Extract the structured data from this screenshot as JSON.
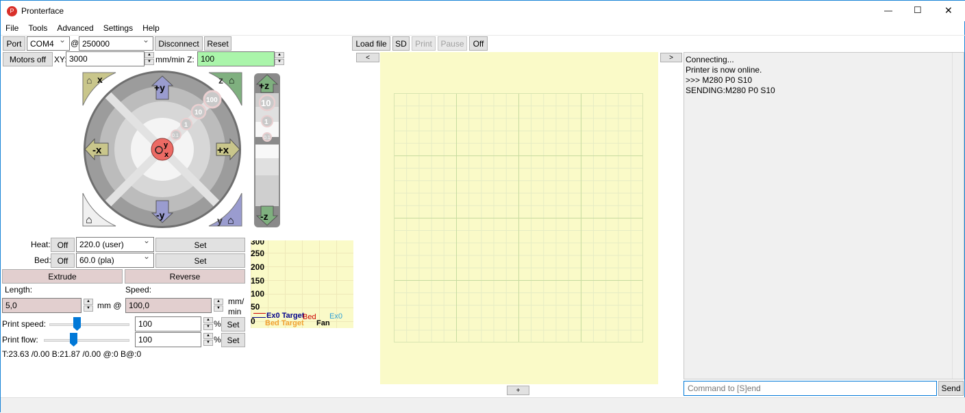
{
  "window": {
    "title": "Pronterface",
    "minimize": "—",
    "maximize": "☐",
    "close": "✕"
  },
  "menu": [
    "File",
    "Tools",
    "Advanced",
    "Settings",
    "Help"
  ],
  "connection": {
    "port_label": "Port",
    "port_value": "COM4",
    "at": "@",
    "baud_value": "250000",
    "disconnect": "Disconnect",
    "reset": "Reset"
  },
  "motion": {
    "motors_off": "Motors off",
    "xy_label": "XY:",
    "xy_value": "3000",
    "units_label": "mm/min Z:",
    "z_value": "100"
  },
  "jog": {
    "home_x": "x",
    "home_z": "z",
    "home_y": "y",
    "plus_y": "+y",
    "minus_y": "-y",
    "plus_x": "+x",
    "minus_x": "-x",
    "plus_z": "+z",
    "minus_z": "-z",
    "steps": [
      "100",
      "10",
      "1",
      "0.1"
    ],
    "z_steps": [
      "10",
      "1",
      "0.1"
    ],
    "center_y": "y",
    "center_x": "x"
  },
  "temps": {
    "heat_label": "Heat:",
    "heat_off": "Off",
    "heat_value": "220.0 (user)",
    "heat_set": "Set",
    "bed_label": "Bed:",
    "bed_off": "Off",
    "bed_value": "60.0 (pla)",
    "bed_set": "Set"
  },
  "extrude": {
    "extrude": "Extrude",
    "reverse": "Reverse",
    "length_label": "Length:",
    "length_value": "5,0",
    "mm_at": "mm @",
    "speed_label": "Speed:",
    "speed_value": "100,0",
    "speed_units1": "mm/",
    "speed_units2": "min"
  },
  "print_speed": {
    "label": "Print speed:",
    "value": "100",
    "pct": "%",
    "set": "Set",
    "slider_fraction": 0.33
  },
  "print_flow": {
    "label": "Print flow:",
    "value": "100",
    "pct": "%",
    "set": "Set",
    "slider_fraction": 0.33
  },
  "status_temps": "T:23.63 /0.00 B:21.87 /0.00 @:0 B@:0",
  "graph": {
    "y_ticks": [
      "300",
      "250",
      "200",
      "150",
      "100",
      "50",
      "0"
    ],
    "legend": {
      "ex0_target": "Ex0 Target",
      "bed": "Bed",
      "ex0": "Ex0",
      "bed_target": "Bed Target",
      "fan": "Fan"
    },
    "colors": {
      "ex0_target": "#00008b",
      "bed": "#cc0000",
      "ex0": "#2a9fd6",
      "bed_target": "#f0a030",
      "fan": "#000000"
    }
  },
  "file_toolbar": {
    "load_file": "Load file",
    "sd": "SD",
    "print": "Print",
    "pause": "Pause",
    "off": "Off"
  },
  "preview": {
    "collapse_left": "<",
    "expand_right": ">",
    "zoom_plus": "+"
  },
  "log": {
    "lines": [
      "Connecting...",
      "Printer is now online.",
      ">>> M280 P0 S10",
      "SENDING:M280 P0 S10"
    ]
  },
  "command": {
    "placeholder": "Command to [S]end",
    "send": "Send"
  }
}
